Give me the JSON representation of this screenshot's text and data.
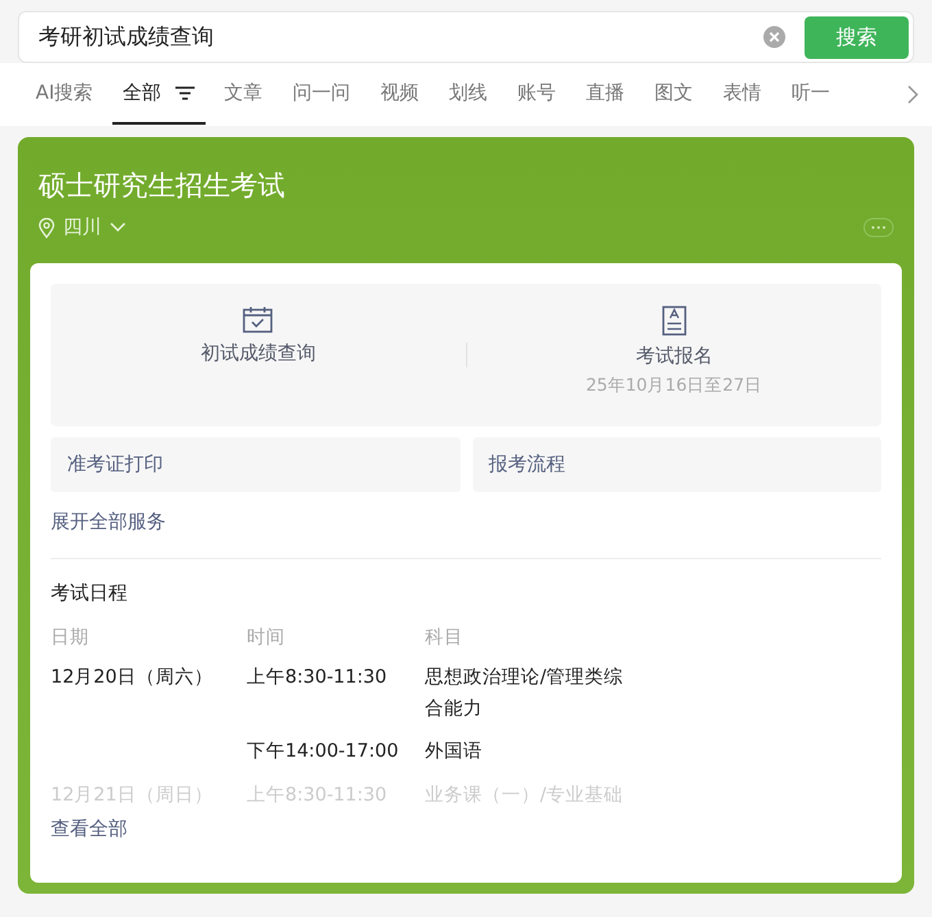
{
  "search": {
    "value": "考研初试成绩查询",
    "button": "搜索"
  },
  "tabs": [
    {
      "label": "AI搜索",
      "selected": false
    },
    {
      "label": "全部",
      "selected": true
    },
    {
      "label": "文章",
      "selected": false
    },
    {
      "label": "问一问",
      "selected": false
    },
    {
      "label": "视频",
      "selected": false
    },
    {
      "label": "划线",
      "selected": false
    },
    {
      "label": "账号",
      "selected": false
    },
    {
      "label": "直播",
      "selected": false
    },
    {
      "label": "图文",
      "selected": false
    },
    {
      "label": "表情",
      "selected": false
    },
    {
      "label": "听一",
      "selected": false
    }
  ],
  "card": {
    "title": "硕士研究生招生考试",
    "region": "四川",
    "services": [
      {
        "kind": "calendar",
        "label": "初试成绩查询"
      },
      {
        "kind": "document",
        "label": "考试报名",
        "note": "25年10月16日至27日"
      }
    ],
    "links": [
      "准考证打印",
      "报考流程"
    ],
    "expand": "展开全部服务",
    "schedule": {
      "title": "考试日程",
      "columns": [
        "日期",
        "时间",
        "科目"
      ],
      "rows": [
        {
          "date": "12月20日（周六）",
          "time": "上午8:30-11:30",
          "subject": "思想政治理论/管理类综合能力",
          "faded": false
        },
        {
          "date": "",
          "time": "下午14:00-17:00",
          "subject": "外国语",
          "faded": false
        },
        {
          "date": "12月21日（周日）",
          "time": "上午8:30-11:30",
          "subject": "业务课（一）/专业基础",
          "faded": true
        }
      ]
    },
    "more": "查看全部"
  }
}
